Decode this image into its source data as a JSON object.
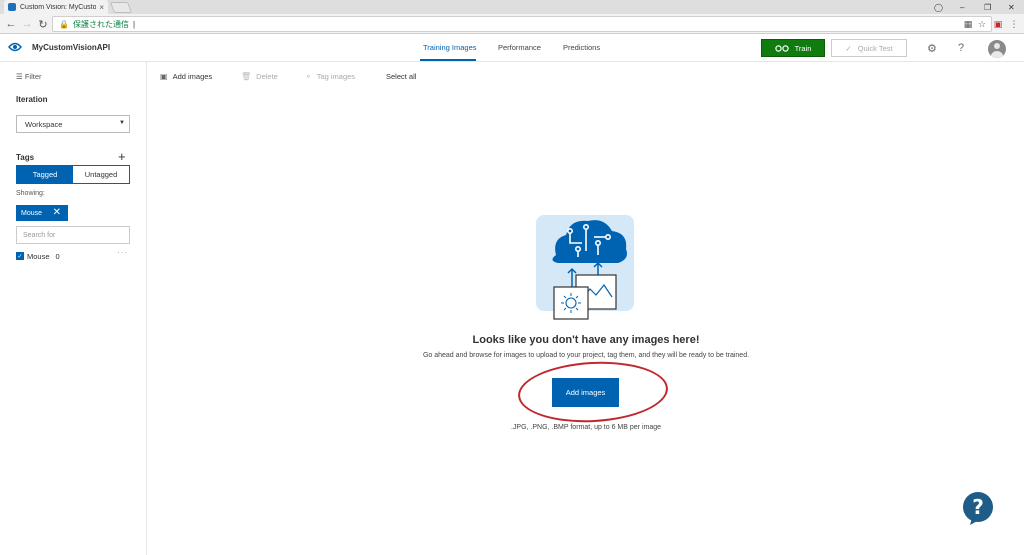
{
  "browser": {
    "tab_title": "Custom Vision: MyCusto",
    "tab_close": "×",
    "url_secure": "保護された通信",
    "url_rest": "|"
  },
  "header": {
    "project_name": "MyCustomVisionAPI",
    "tabs": [
      {
        "label": "Training Images",
        "active": true
      },
      {
        "label": "Performance",
        "active": false
      },
      {
        "label": "Predictions",
        "active": false
      }
    ],
    "train_label": "Train",
    "quick_test_label": "Quick Test"
  },
  "sidebar": {
    "filter_label": "Filter",
    "iteration_label": "Iteration",
    "workspace_value": "Workspace",
    "tags_label": "Tags",
    "tagged_label": "Tagged",
    "untagged_label": "Untagged",
    "showing_label": "Showing:",
    "chip_label": "Mouse",
    "search_placeholder": "Search for",
    "tag_items": [
      {
        "name": "Mouse",
        "count": "0",
        "checked": true
      }
    ]
  },
  "toolbar": {
    "add_images": "Add images",
    "delete": "Delete",
    "tag_images": "Tag images",
    "select_all": "Select all"
  },
  "empty_state": {
    "title": "Looks like you don't have any images here!",
    "subtitle": "Go ahead and browse for images to upload to your project, tag them, and they will be ready to be trained.",
    "button_label": "Add images",
    "formats_text": ".JPG, .PNG, .BMP format, up to 6 MB per image"
  },
  "colors": {
    "accent": "#0063b1",
    "train_green": "#107c10",
    "annotation_red": "#c0282d"
  }
}
